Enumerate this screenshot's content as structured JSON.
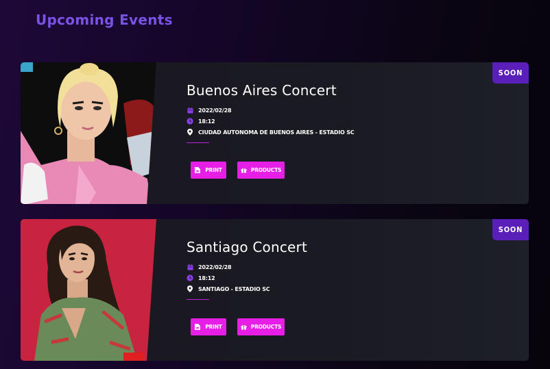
{
  "page": {
    "title": "Upcoming Events"
  },
  "colors": {
    "accent": "#e61ee6",
    "badge": "#5a1fb8",
    "heading": "#7b52e6",
    "icon": "#8a3fe8"
  },
  "events": [
    {
      "badge": "SOON",
      "title": "Buenos Aires Concert",
      "date": "2022/02/28",
      "time": "18:12",
      "location": "CIUDAD AUTONOMA DE BUENOS AIRES - ESTADIO SC",
      "print_label": "PRINT",
      "products_label": "PRODUCTS"
    },
    {
      "badge": "SOON",
      "title": "Santiago Concert",
      "date": "2022/02/28",
      "time": "18:12",
      "location": "SANTIAGO - ESTADIO SC",
      "print_label": "PRINT",
      "products_label": "PRODUCTS"
    }
  ],
  "icons": {
    "date": "calendar-icon",
    "time": "clock-icon",
    "location": "map-pin-icon",
    "print": "file-icon",
    "products": "gift-icon"
  }
}
